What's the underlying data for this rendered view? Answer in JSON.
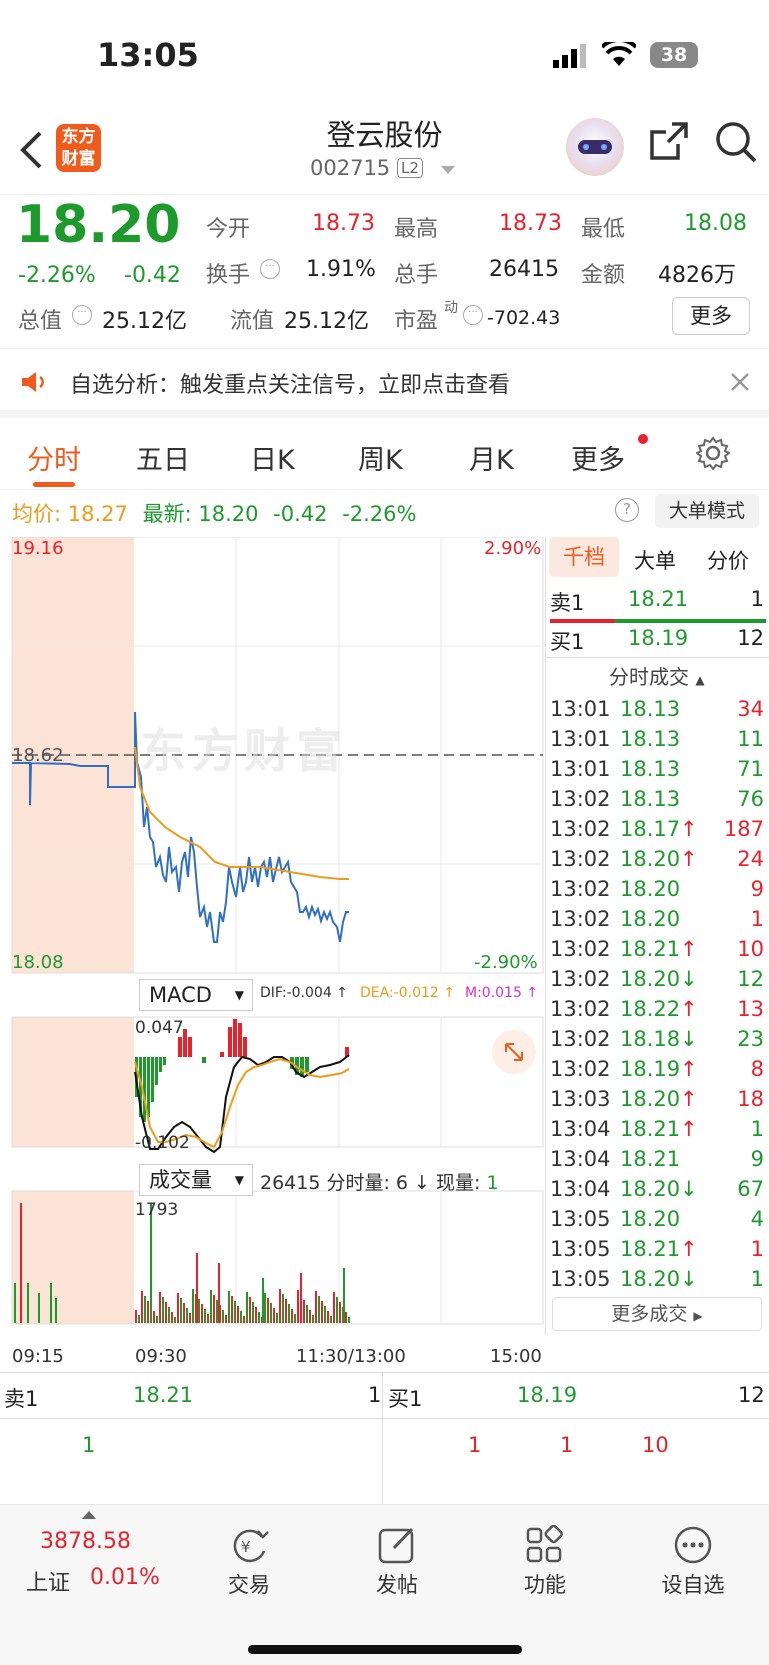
{
  "status": {
    "time": "13:05",
    "battery": "38"
  },
  "header": {
    "name": "登云股份",
    "code": "002715",
    "level": "L2",
    "logo_line1": "东方",
    "logo_line2": "财富"
  },
  "quote": {
    "price": "18.20",
    "pct": "-2.26%",
    "chg": "-0.42",
    "open_label": "今开",
    "open": "18.73",
    "high_label": "最高",
    "high": "18.73",
    "low_label": "最低",
    "low": "18.08",
    "turnover_label": "换手",
    "turnover": "1.91%",
    "vol_label": "总手",
    "vol": "26415",
    "amount_label": "金额",
    "amount": "4826万",
    "mcap_label": "总值",
    "mcap": "25.12亿",
    "float_label": "流值",
    "float": "25.12亿",
    "pe_label": "市盈",
    "pe_sup": "动",
    "pe": "-702.43",
    "more": "更多"
  },
  "banner": {
    "text": "自选分析：触发重点关注信号，立即点击查看"
  },
  "tabs": [
    "分时",
    "五日",
    "日K",
    "周K",
    "月K",
    "更多"
  ],
  "info": {
    "avg_label": "均价:",
    "avg": "18.27",
    "last_label": "最新:",
    "last": "18.20",
    "chg": "-0.42",
    "pct": "-2.26%",
    "mode": "大单模式"
  },
  "chart": {
    "y_top": "19.16",
    "y_mid": "18.62",
    "y_bot": "18.08",
    "pct_top": "2.90%",
    "pct_bot": "-2.90%",
    "watermark": "东方财富",
    "macd_label": "MACD",
    "dif": "DIF:-0.004 ↑",
    "dea": "DEA:-0.012 ↑",
    "m": "M:0.015 ↑",
    "macd_top": "0.047",
    "macd_bot": "-0.102",
    "vol_label": "成交量",
    "vol_info": "26415 分时量: 6 ↓ 现量: ",
    "vol_now": "1",
    "vol_max": "1793",
    "x_labels": [
      "09:15",
      "09:30",
      "11:30/13:00",
      "15:00"
    ]
  },
  "panel": {
    "tabs": [
      "千档",
      "大单",
      "分价"
    ],
    "ask_label": "卖1",
    "ask": "18.21",
    "ask_vol": "1",
    "bid_label": "买1",
    "bid": "18.19",
    "bid_vol": "12",
    "trades_title": "分时成交",
    "more": "更多成交",
    "trades": [
      [
        "13:01",
        "18.13",
        "",
        "34",
        "r"
      ],
      [
        "13:01",
        "18.13",
        "",
        "11",
        "g"
      ],
      [
        "13:01",
        "18.13",
        "",
        "71",
        "g"
      ],
      [
        "13:02",
        "18.13",
        "",
        "76",
        "g"
      ],
      [
        "13:02",
        "18.17",
        "↑",
        "187",
        "r"
      ],
      [
        "13:02",
        "18.20",
        "↑",
        "24",
        "r"
      ],
      [
        "13:02",
        "18.20",
        "",
        "9",
        "r"
      ],
      [
        "13:02",
        "18.20",
        "",
        "1",
        "r"
      ],
      [
        "13:02",
        "18.21",
        "↑",
        "10",
        "r"
      ],
      [
        "13:02",
        "18.20",
        "↓",
        "12",
        "g"
      ],
      [
        "13:02",
        "18.22",
        "↑",
        "13",
        "r"
      ],
      [
        "13:02",
        "18.18",
        "↓",
        "23",
        "g"
      ],
      [
        "13:02",
        "18.19",
        "↑",
        "8",
        "r"
      ],
      [
        "13:03",
        "18.20",
        "↑",
        "18",
        "r"
      ],
      [
        "13:04",
        "18.21",
        "↑",
        "1",
        "g"
      ],
      [
        "13:04",
        "18.21",
        "",
        "9",
        "g"
      ],
      [
        "13:04",
        "18.20",
        "↓",
        "67",
        "g"
      ],
      [
        "13:05",
        "18.20",
        "",
        "4",
        "g"
      ],
      [
        "13:05",
        "18.21",
        "↑",
        "1",
        "r"
      ],
      [
        "13:05",
        "18.20",
        "↓",
        "1",
        "g"
      ]
    ]
  },
  "bottomq": {
    "ask_label": "卖1",
    "ask": "18.21",
    "ask_vol": "1",
    "bid_label": "买1",
    "bid": "18.19",
    "bid_vol": "12",
    "left_val": "1",
    "r1": "1",
    "r2": "1",
    "r3": "10"
  },
  "nav": {
    "index_val": "3878.58",
    "index_name": "上证",
    "index_pct": "0.01%",
    "items": [
      "交易",
      "发帖",
      "功能",
      "设自选"
    ]
  }
}
